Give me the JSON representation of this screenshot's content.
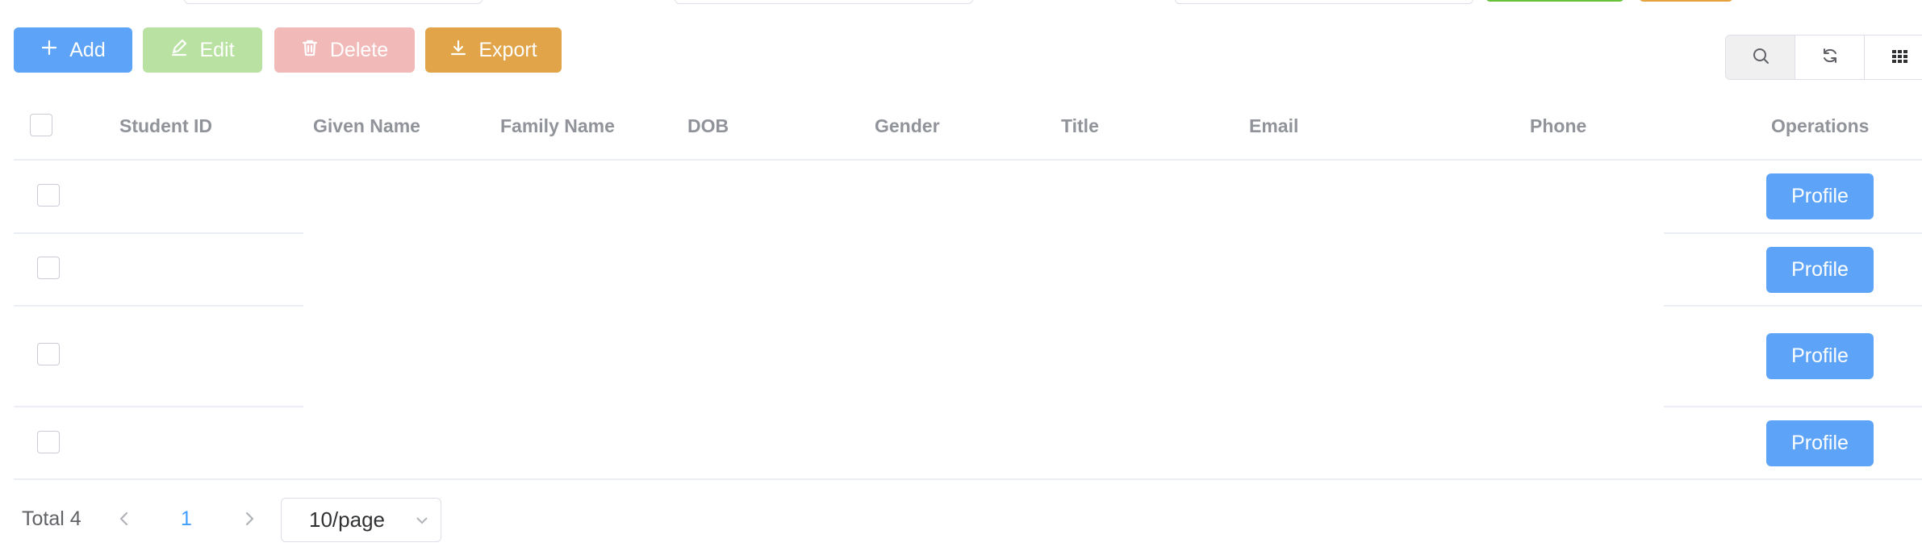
{
  "toolbar": {
    "add_label": "Add",
    "edit_label": "Edit",
    "delete_label": "Delete",
    "export_label": "Export"
  },
  "tools": {
    "search_icon": "search-icon",
    "refresh_icon": "refresh-icon",
    "columns_icon": "columns-grid-icon"
  },
  "table": {
    "columns": [
      "Student ID",
      "Given Name",
      "Family Name",
      "DOB",
      "Gender",
      "Title",
      "Email",
      "Phone",
      "Operations"
    ],
    "rows": [
      {
        "action_label": "Profile"
      },
      {
        "action_label": "Profile"
      },
      {
        "action_label": "Profile"
      },
      {
        "action_label": "Profile"
      }
    ]
  },
  "pagination": {
    "total_label": "Total 4",
    "current_page": "1",
    "page_size": "10/page"
  },
  "colors": {
    "primary": "#5da4f8",
    "success_light": "#b9e2a2",
    "danger_light": "#f2b9b9",
    "warning": "#e1a449"
  }
}
